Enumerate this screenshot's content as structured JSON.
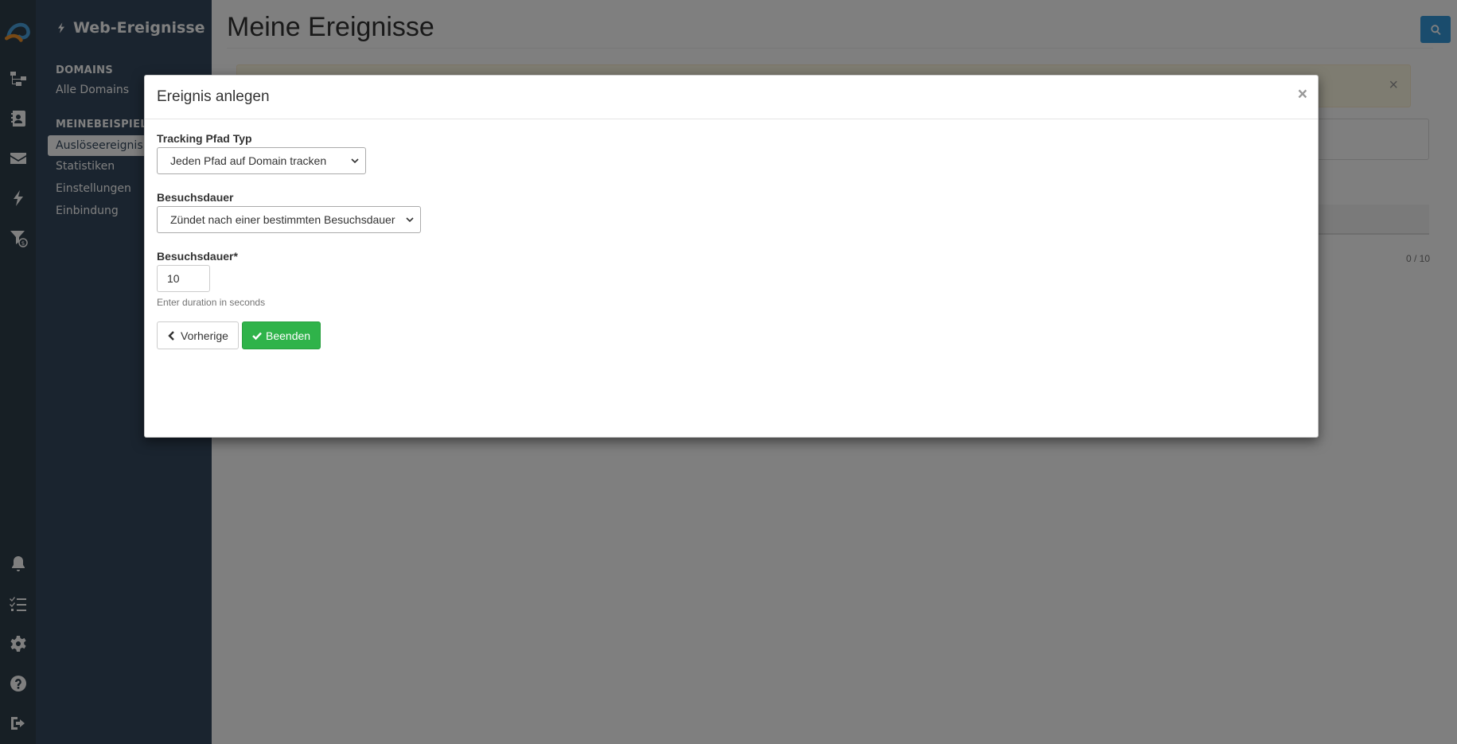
{
  "rail": {
    "icons": [
      "logo-icon",
      "sitemap-icon",
      "contacts-icon",
      "envelope-icon",
      "bolt-icon",
      "funnel-icon",
      "bell-icon",
      "tasks-icon",
      "gear-icon",
      "help-icon",
      "logout-icon"
    ]
  },
  "subnav": {
    "title": "Web-Ereignisse",
    "sections": [
      {
        "label": "DOMAINS",
        "items": [
          "Alle Domains"
        ]
      },
      {
        "label": "MEINEBEISPIELD",
        "items": [
          "Auslöseereignis",
          "Statistiken",
          "Einstellungen",
          "Einbindung"
        ]
      }
    ],
    "active_item": "Auslöseereignis"
  },
  "main": {
    "title": "Meine Ereignisse",
    "alert_close": "×",
    "pager": "0 / 10"
  },
  "modal": {
    "title": "Ereignis anlegen",
    "close": "×",
    "fields": {
      "tracking_label": "Tracking Pfad Typ",
      "tracking_value": "Jeden Pfad auf Domain tracken",
      "duration_type_label": "Besuchsdauer",
      "duration_type_value": "Zündet nach einer bestimmten Besuchsdauer",
      "duration_label": "Besuchsdauer*",
      "duration_value": "10",
      "duration_help": "Enter duration in seconds"
    },
    "buttons": {
      "back": "Vorherige",
      "finish": "Beenden"
    }
  },
  "colors": {
    "rail_bg": "#2f3e4a",
    "subnav_bg": "#34495e",
    "accent": "#3498db",
    "success": "#2fb34a"
  }
}
